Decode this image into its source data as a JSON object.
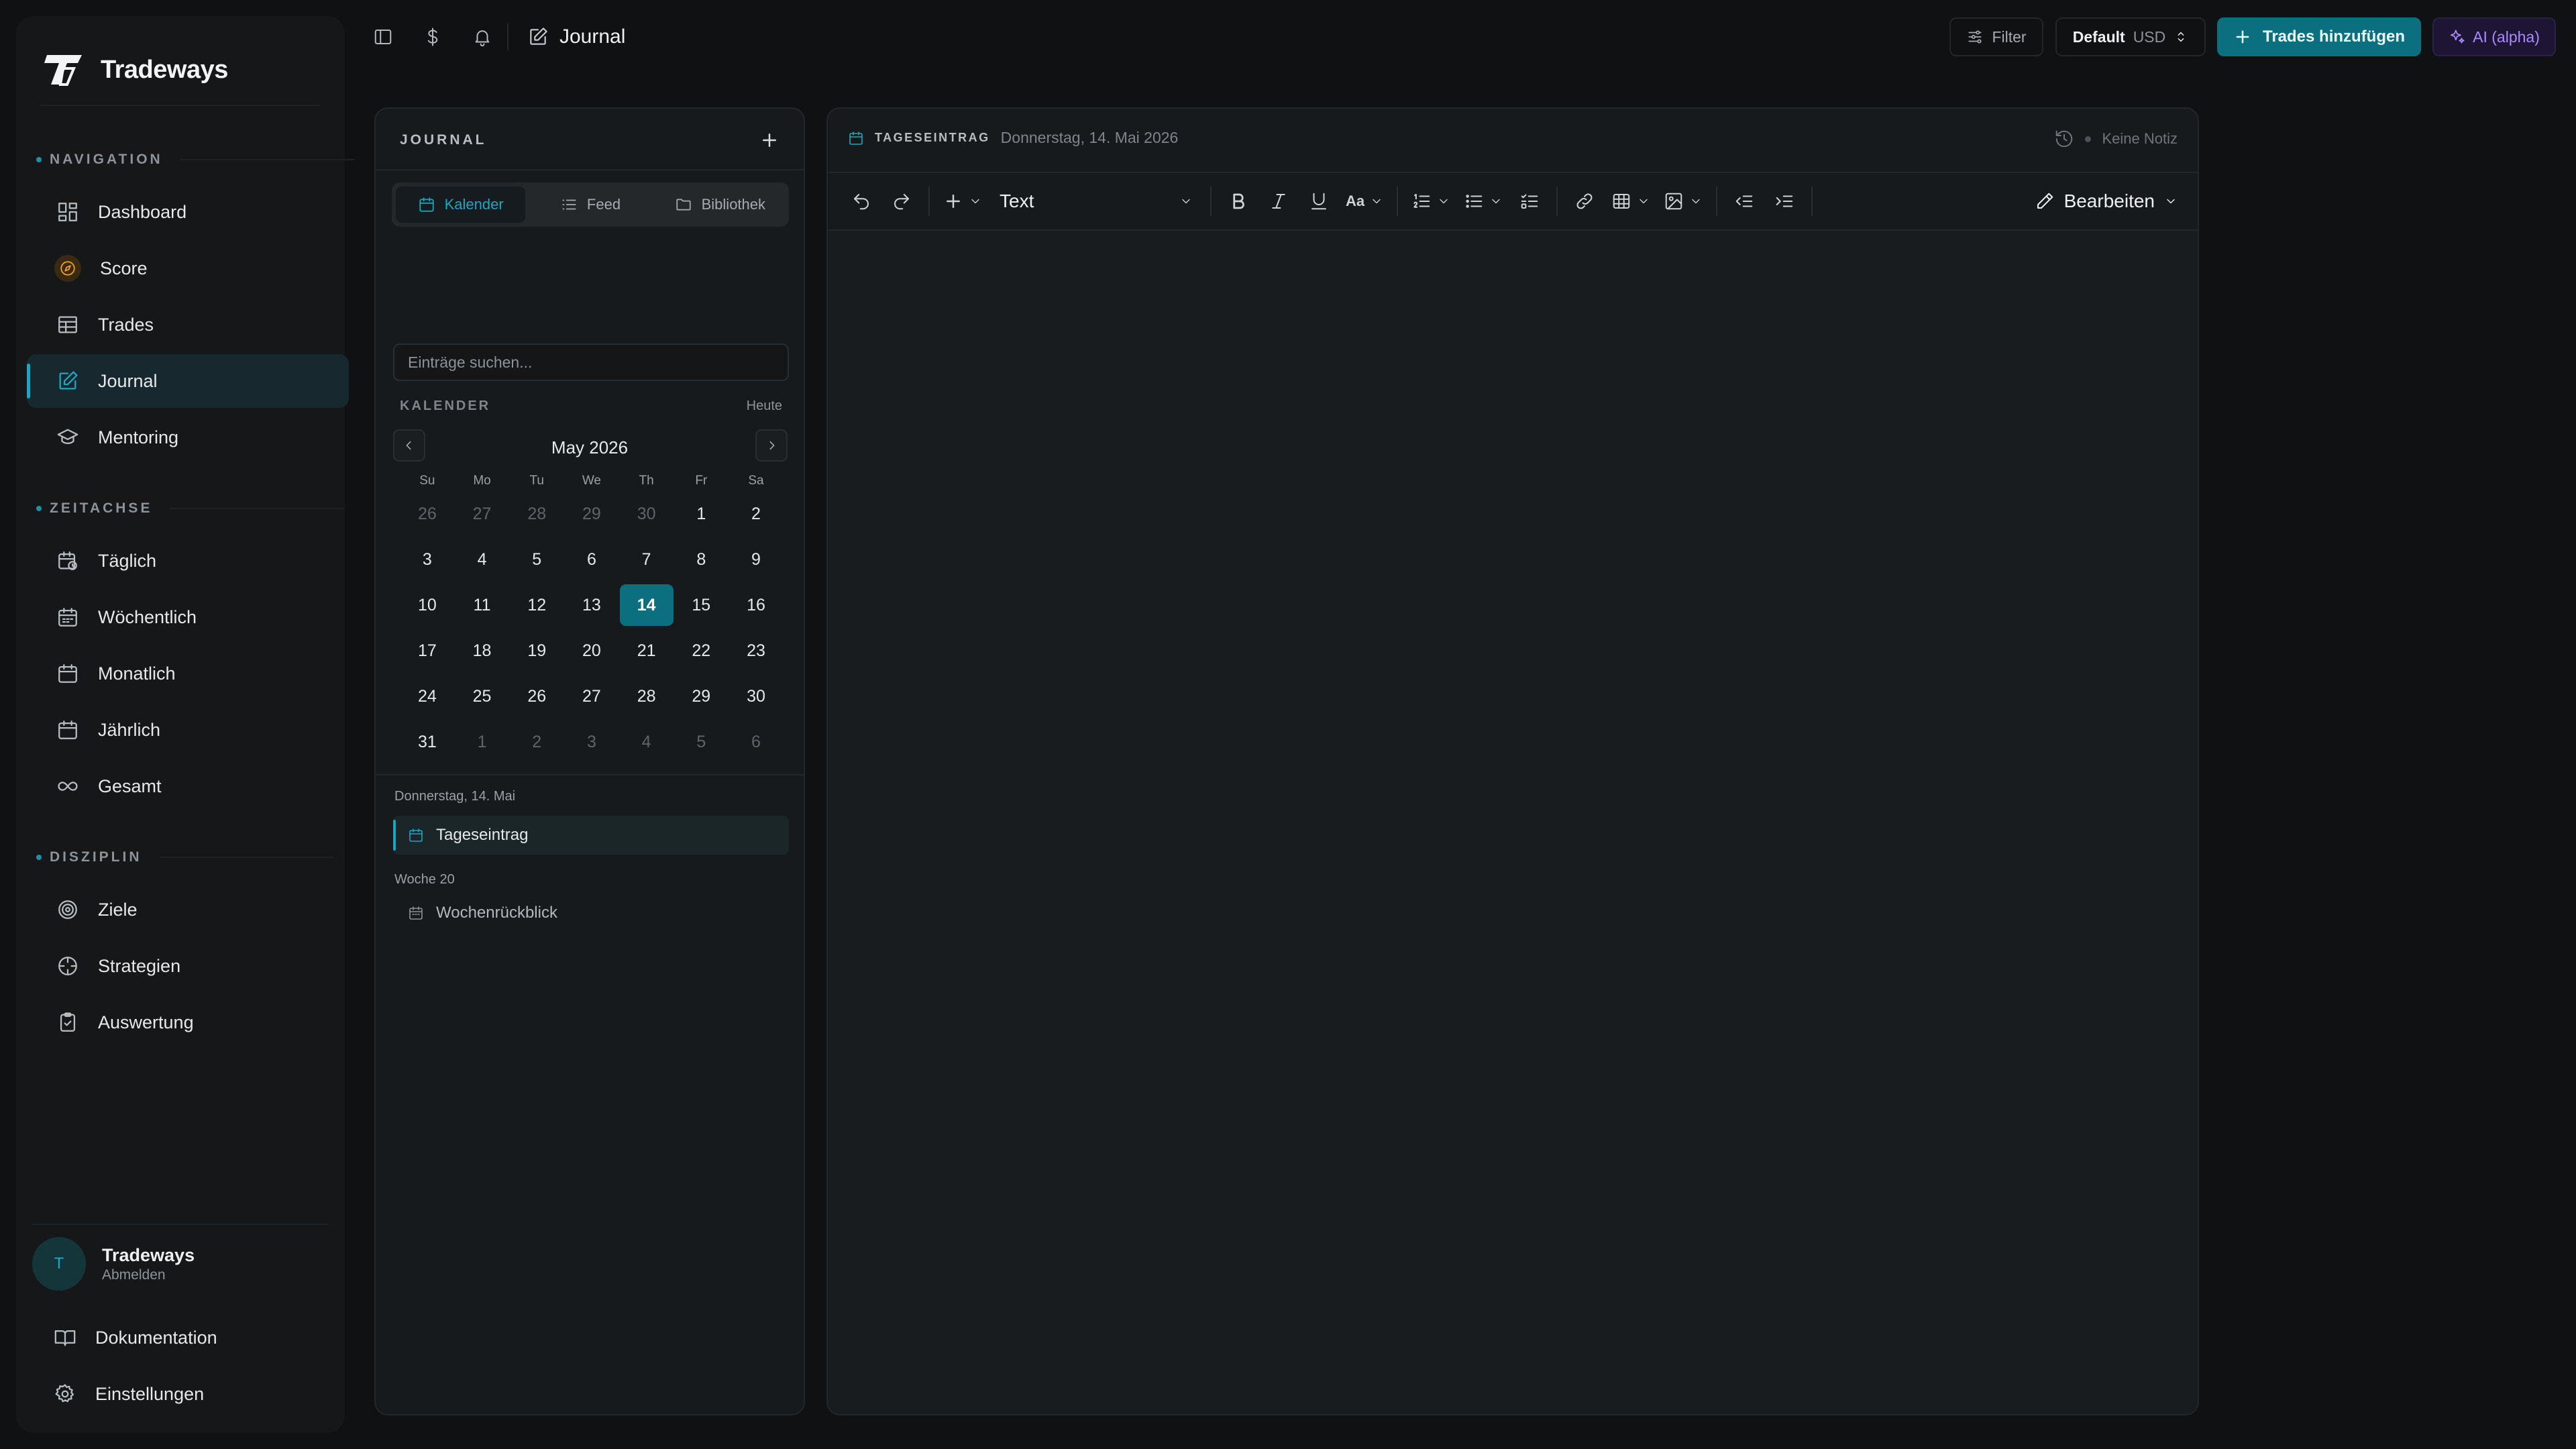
{
  "app": {
    "name": "Tradeways"
  },
  "sidebar": {
    "sections": [
      {
        "label": "NAVIGATION"
      },
      {
        "label": "ZEITACHSE"
      },
      {
        "label": "DISZIPLIN"
      }
    ],
    "items": [
      {
        "label": "Dashboard",
        "icon": "dashboard-grid-icon"
      },
      {
        "label": "Score",
        "icon": "compass-icon"
      },
      {
        "label": "Trades",
        "icon": "table-icon"
      },
      {
        "label": "Journal",
        "icon": "edit-note-icon",
        "active": true
      },
      {
        "label": "Mentoring",
        "icon": "graduation-cap-icon"
      },
      {
        "label": "Täglich",
        "icon": "calendar-clock-icon"
      },
      {
        "label": "Wöchentlich",
        "icon": "calendar-week-icon"
      },
      {
        "label": "Monatlich",
        "icon": "calendar-month-icon"
      },
      {
        "label": "Jährlich",
        "icon": "calendar-icon"
      },
      {
        "label": "Gesamt",
        "icon": "infinity-icon"
      },
      {
        "label": "Ziele",
        "icon": "target-icon"
      },
      {
        "label": "Strategien",
        "icon": "crosshair-icon"
      },
      {
        "label": "Auswertung",
        "icon": "clipboard-check-icon"
      }
    ],
    "user": {
      "initial": "T",
      "name": "Tradeways",
      "action": "Abmelden"
    },
    "footer": [
      {
        "label": "Dokumentation",
        "icon": "book-icon"
      },
      {
        "label": "Einstellungen",
        "icon": "gear-icon"
      }
    ]
  },
  "topbar": {
    "title": "Journal",
    "filter_label": "Filter",
    "account_label": "Default",
    "currency": "USD",
    "add_trades_label": "Trades hinzufügen",
    "ai_label": "AI (alpha)"
  },
  "journal": {
    "title": "JOURNAL",
    "tabs": [
      {
        "label": "Kalender",
        "active": true
      },
      {
        "label": "Feed"
      },
      {
        "label": "Bibliothek"
      }
    ],
    "search_placeholder": "Einträge suchen...",
    "calendar_label": "KALENDER",
    "today_label": "Heute",
    "month_label": "May 2026",
    "weekdays": [
      "Su",
      "Mo",
      "Tu",
      "We",
      "Th",
      "Fr",
      "Sa"
    ],
    "weeks": [
      [
        [
          "26",
          1
        ],
        [
          "27",
          1
        ],
        [
          "28",
          1
        ],
        [
          "29",
          1
        ],
        [
          "30",
          1
        ],
        [
          "1",
          0
        ],
        [
          "2",
          0
        ]
      ],
      [
        [
          "3",
          0
        ],
        [
          "4",
          0
        ],
        [
          "5",
          0
        ],
        [
          "6",
          0
        ],
        [
          "7",
          0
        ],
        [
          "8",
          0
        ],
        [
          "9",
          0
        ]
      ],
      [
        [
          "10",
          0
        ],
        [
          "11",
          0
        ],
        [
          "12",
          0
        ],
        [
          "13",
          0
        ],
        [
          "14",
          2
        ],
        [
          "15",
          0
        ],
        [
          "16",
          0
        ]
      ],
      [
        [
          "17",
          0
        ],
        [
          "18",
          0
        ],
        [
          "19",
          0
        ],
        [
          "20",
          0
        ],
        [
          "21",
          0
        ],
        [
          "22",
          0
        ],
        [
          "23",
          0
        ]
      ],
      [
        [
          "24",
          0
        ],
        [
          "25",
          0
        ],
        [
          "26",
          0
        ],
        [
          "27",
          0
        ],
        [
          "28",
          0
        ],
        [
          "29",
          0
        ],
        [
          "30",
          0
        ]
      ],
      [
        [
          "31",
          0
        ],
        [
          "1",
          1
        ],
        [
          "2",
          1
        ],
        [
          "3",
          1
        ],
        [
          "4",
          1
        ],
        [
          "5",
          1
        ],
        [
          "6",
          1
        ]
      ]
    ],
    "groups": [
      {
        "label": "Donnerstag, 14. Mai",
        "entry": "Tageseintrag"
      },
      {
        "label": "Woche 20",
        "entry": "Wochenrückblick"
      }
    ]
  },
  "editor": {
    "kind_label": "TAGESEINTRAG",
    "date_label": "Donnerstag, 14. Mai 2026",
    "status": "Keine Notiz",
    "block_type": "Text",
    "font_size_label": "Aa",
    "mode_label": "Bearbeiten"
  },
  "colors": {
    "accent": "#0b6f80",
    "accent_bright": "#19a7bf",
    "score": "#f5a524",
    "ai": "#a98bff"
  }
}
